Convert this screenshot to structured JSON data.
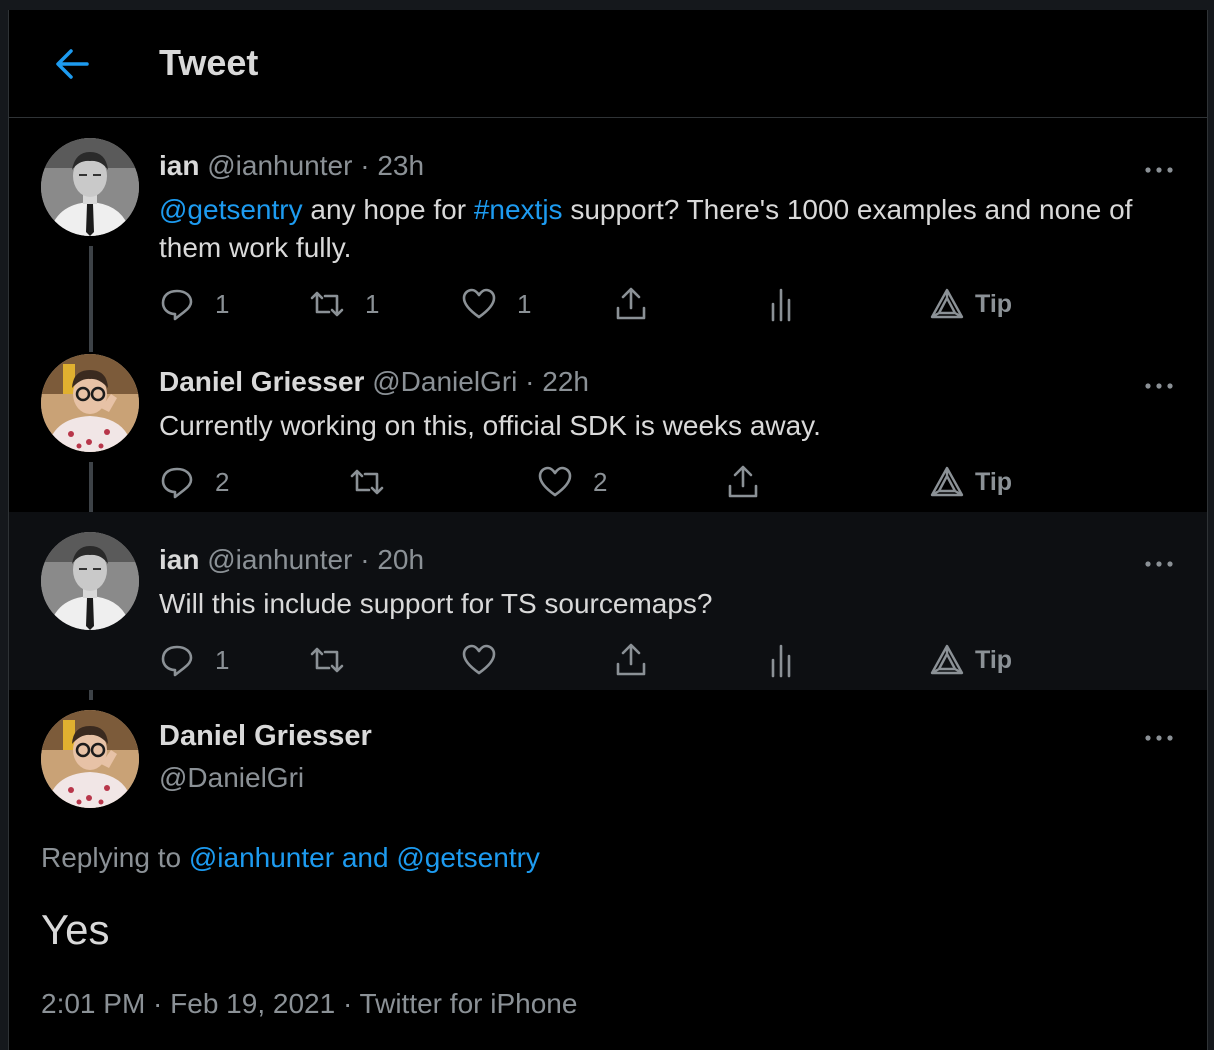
{
  "header": {
    "title": "Tweet"
  },
  "tweets": [
    {
      "name": "ian",
      "handle": "@ianhunter",
      "sep": "·",
      "time": "23h",
      "text_parts": [
        "@getsentry",
        " any hope for ",
        "#nextjs",
        " support? There's 1000 examples and none of them work fully."
      ],
      "replies": "1",
      "retweets": "1",
      "likes": "1",
      "tip": "Tip"
    },
    {
      "name": "Daniel Griesser",
      "handle": "@DanielGri",
      "sep": "·",
      "time": "22h",
      "text": "Currently working on this, official SDK is weeks away.",
      "replies": "2",
      "likes": "2",
      "tip": "Tip"
    },
    {
      "name": "ian",
      "handle": "@ianhunter",
      "sep": "·",
      "time": "20h",
      "text": "Will this include support for TS sourcemaps?",
      "replies": "1",
      "tip": "Tip"
    }
  ],
  "main_tweet": {
    "name": "Daniel Griesser",
    "handle": "@DanielGri",
    "replying_prefix": "Replying to ",
    "replying_to": "@ianhunter and @getsentry",
    "text": "Yes",
    "timestamp": "2:01 PM · Feb 19, 2021 · Twitter for iPhone"
  },
  "icons": {
    "back": "arrow-left-icon",
    "reply": "reply-bubble-icon",
    "retweet": "retweet-icon",
    "like": "heart-icon",
    "share": "share-icon",
    "analytics": "analytics-icon",
    "tip": "tip-icon",
    "more": "more-dots-icon"
  },
  "colors": {
    "accent": "#1d9bf0",
    "background": "#000000",
    "text": "#d9d9d9",
    "muted": "#8b9196"
  }
}
